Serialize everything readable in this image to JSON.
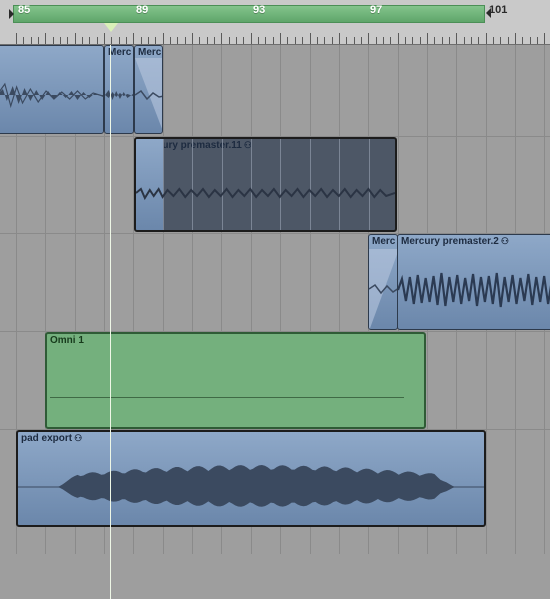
{
  "ruler": {
    "bar_numbers": [
      "85",
      "89",
      "93",
      "97",
      "101"
    ]
  },
  "regions": {
    "r1_label": "",
    "merc_a": "Merc",
    "merc_b": "Merc",
    "premaster11": "Mercury premaster.11",
    "merc_c": "Merc",
    "premaster2": "Mercury premaster.2",
    "omni": "Omni 1",
    "pad_export": "pad export"
  },
  "icons": {
    "loop": "loop-icon"
  },
  "colors": {
    "audio_region": "#7a96ba",
    "midi_region": "#74b07d",
    "cycle": "#6fb479",
    "playhead": "#eef7e6"
  }
}
